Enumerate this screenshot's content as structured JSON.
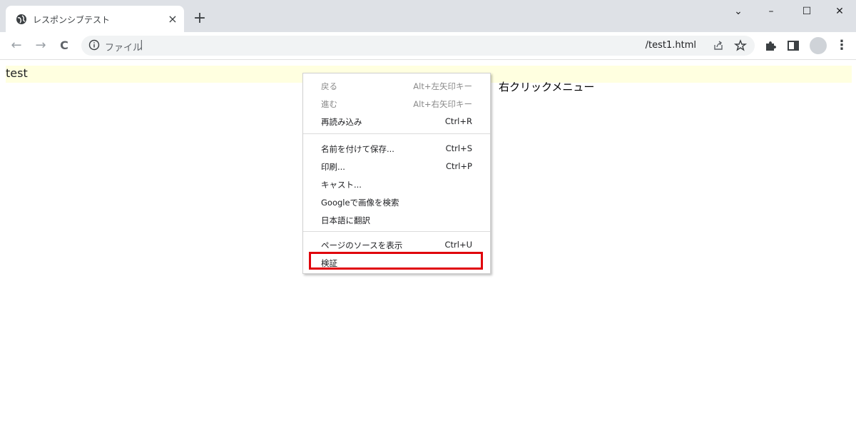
{
  "browser": {
    "tab": {
      "title": "レスポンシブテスト",
      "close_glyph": "×",
      "favicon": "globe-icon"
    },
    "new_tab_glyph": "+",
    "window_controls": {
      "chevron": "⌄",
      "minimize": "–",
      "maximize": "☐",
      "close": "✕"
    },
    "nav": {
      "back": "←",
      "forward": "→",
      "reload": "C"
    },
    "omnibox": {
      "scheme_label": "ファイル",
      "separator": "|",
      "url_suffix": "/test1.html",
      "share_icon": "share-icon",
      "bookmark_icon": "star-icon"
    },
    "toolbar_icons": [
      "puzzle-icon",
      "sidepanel-icon",
      "avatar",
      "kebab-menu-icon"
    ],
    "menu_glyph": "⋮"
  },
  "page": {
    "test_text": "test",
    "annotation": "右クリックメニュー",
    "highlight_color": "#e0000b",
    "background_highlight": "#ffffe0"
  },
  "context_menu": {
    "groups": [
      [
        {
          "label": "戻る",
          "shortcut": "Alt+左矢印キー",
          "disabled": true
        },
        {
          "label": "進む",
          "shortcut": "Alt+右矢印キー",
          "disabled": true
        },
        {
          "label": "再読み込み",
          "shortcut": "Ctrl+R",
          "disabled": false
        }
      ],
      [
        {
          "label": "名前を付けて保存...",
          "shortcut": "Ctrl+S",
          "disabled": false
        },
        {
          "label": "印刷...",
          "shortcut": "Ctrl+P",
          "disabled": false
        },
        {
          "label": "キャスト...",
          "shortcut": "",
          "disabled": false
        },
        {
          "label": "Googleで画像を検索",
          "shortcut": "",
          "disabled": false
        },
        {
          "label": "日本語に翻訳",
          "shortcut": "",
          "disabled": false
        }
      ],
      [
        {
          "label": "ページのソースを表示",
          "shortcut": "Ctrl+U",
          "disabled": false
        },
        {
          "label": "検証",
          "shortcut": "",
          "disabled": false
        }
      ]
    ]
  }
}
